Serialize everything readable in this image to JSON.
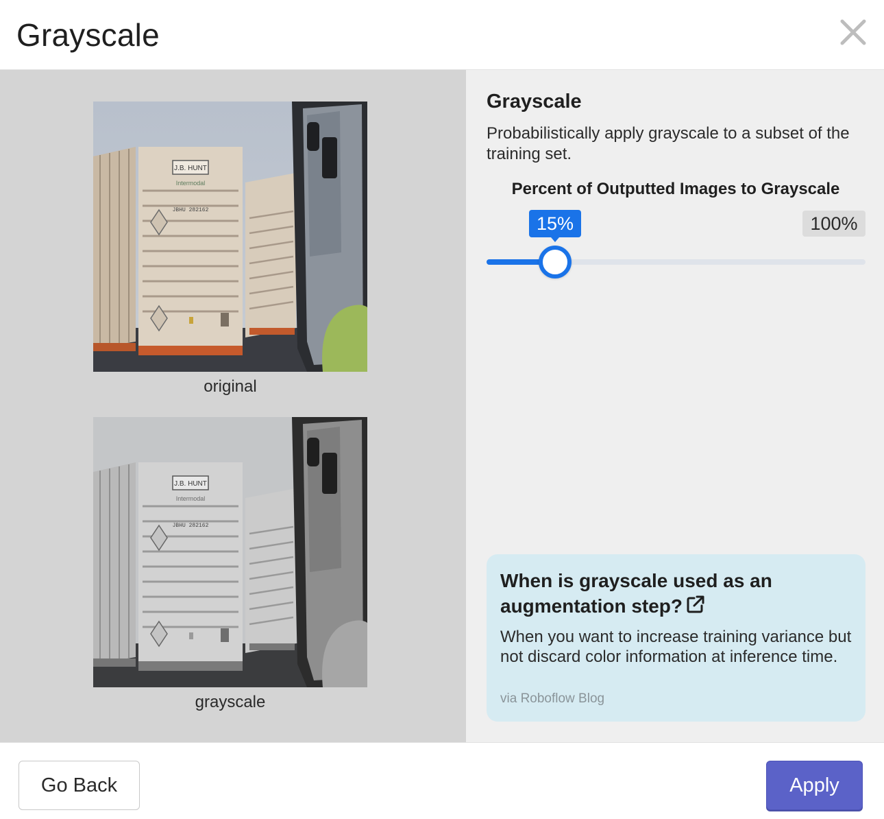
{
  "header": {
    "title": "Grayscale",
    "close_icon": "close-icon"
  },
  "preview": {
    "items": [
      {
        "caption": "original",
        "image_label": "J.B. HUNT",
        "image_sublabel": "Intermodal",
        "image_code": "JBHU 282162"
      },
      {
        "caption": "grayscale",
        "image_label": "J.B. HUNT",
        "image_sublabel": "Intermodal",
        "image_code": "JBHU 282162"
      }
    ]
  },
  "settings": {
    "title": "Grayscale",
    "description": "Probabilistically apply grayscale to a subset of the training set.",
    "slider": {
      "label": "Percent of Outputted Images to Grayscale",
      "value_label": "15%",
      "max_label": "100%",
      "value_fraction": 0.18
    },
    "info": {
      "title": "When is grayscale used as an augmentation step?",
      "link_icon": "external-link-icon",
      "body": "When you want to increase training variance but not discard color information at inference time.",
      "source": "via Roboflow Blog"
    }
  },
  "colors": {
    "accent": "#1a73e8",
    "apply_button": "#5b62c8",
    "info_card": "#d6ebf2"
  },
  "footer": {
    "back_label": "Go Back",
    "apply_label": "Apply"
  }
}
